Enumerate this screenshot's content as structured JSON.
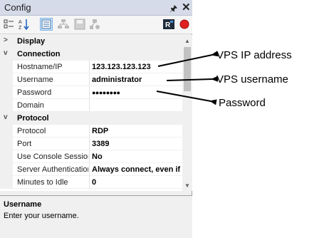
{
  "panel": {
    "title": "Config",
    "pin_icon": "pin-icon",
    "close_icon": "close-icon"
  },
  "toolbar": {
    "icons": [
      "categorized-icon",
      "sort-alphabetical-icon",
      "property-pages-icon",
      "connect-icon",
      "save-icon",
      "share-icon",
      "remote-app-icon",
      "stop-record-icon"
    ],
    "stop_color": "#e02020"
  },
  "grid": {
    "categories": {
      "display": {
        "label": "Display",
        "expanded": false
      },
      "connection": {
        "label": "Connection",
        "expanded": true
      },
      "protocol": {
        "label": "Protocol",
        "expanded": true
      }
    },
    "connection": [
      {
        "name": "Hostname/IP",
        "value": "123.123.123.123"
      },
      {
        "name": "Username",
        "value": "administrator"
      },
      {
        "name": "Password",
        "value": "●●●●●●●●"
      },
      {
        "name": "Domain",
        "value": ""
      }
    ],
    "protocol": [
      {
        "name": "Protocol",
        "value": "RDP"
      },
      {
        "name": "Port",
        "value": "3389"
      },
      {
        "name": "Use Console Session",
        "value": "No"
      },
      {
        "name": "Server Authentication",
        "value": "Always connect, even if authentication fails"
      },
      {
        "name": "Minutes to Idle",
        "value": "0"
      }
    ]
  },
  "description": {
    "title": "Username",
    "text": "Enter your username."
  },
  "annotations": {
    "ip": "VPS IP address",
    "username": "VPS username",
    "password": "Password"
  }
}
